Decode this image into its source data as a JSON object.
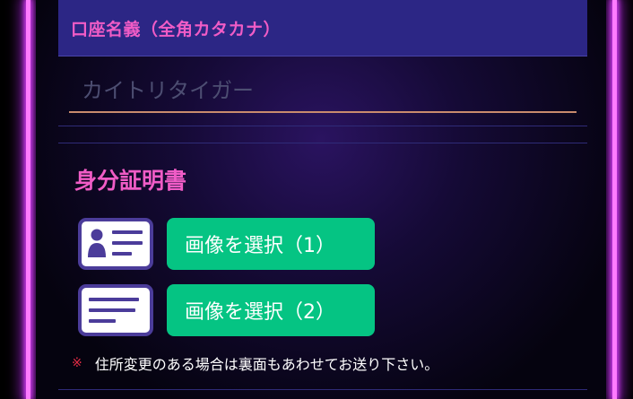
{
  "account_name_field": {
    "label": "口座名義（全角カタカナ）",
    "placeholder": "カイトリタイガー",
    "value": ""
  },
  "id_section": {
    "title": "身分証明書",
    "upload_buttons": [
      {
        "label": "画像を選択（1）",
        "icon": "id-card-icon"
      },
      {
        "label": "画像を選択（2）",
        "icon": "document-icon"
      }
    ],
    "note_mark": "※",
    "note_text": "住所変更のある場合は裏面もあわせてお送り下さい。"
  },
  "colors": {
    "frame_glow": "#ff7bff",
    "header_bg": "#2c2685",
    "accent_pink": "#f05cc6",
    "button_green": "#05c483",
    "icon_purple": "#4b3c9a",
    "note_red": "#e22c45",
    "input_underline": "#c98b6d"
  }
}
